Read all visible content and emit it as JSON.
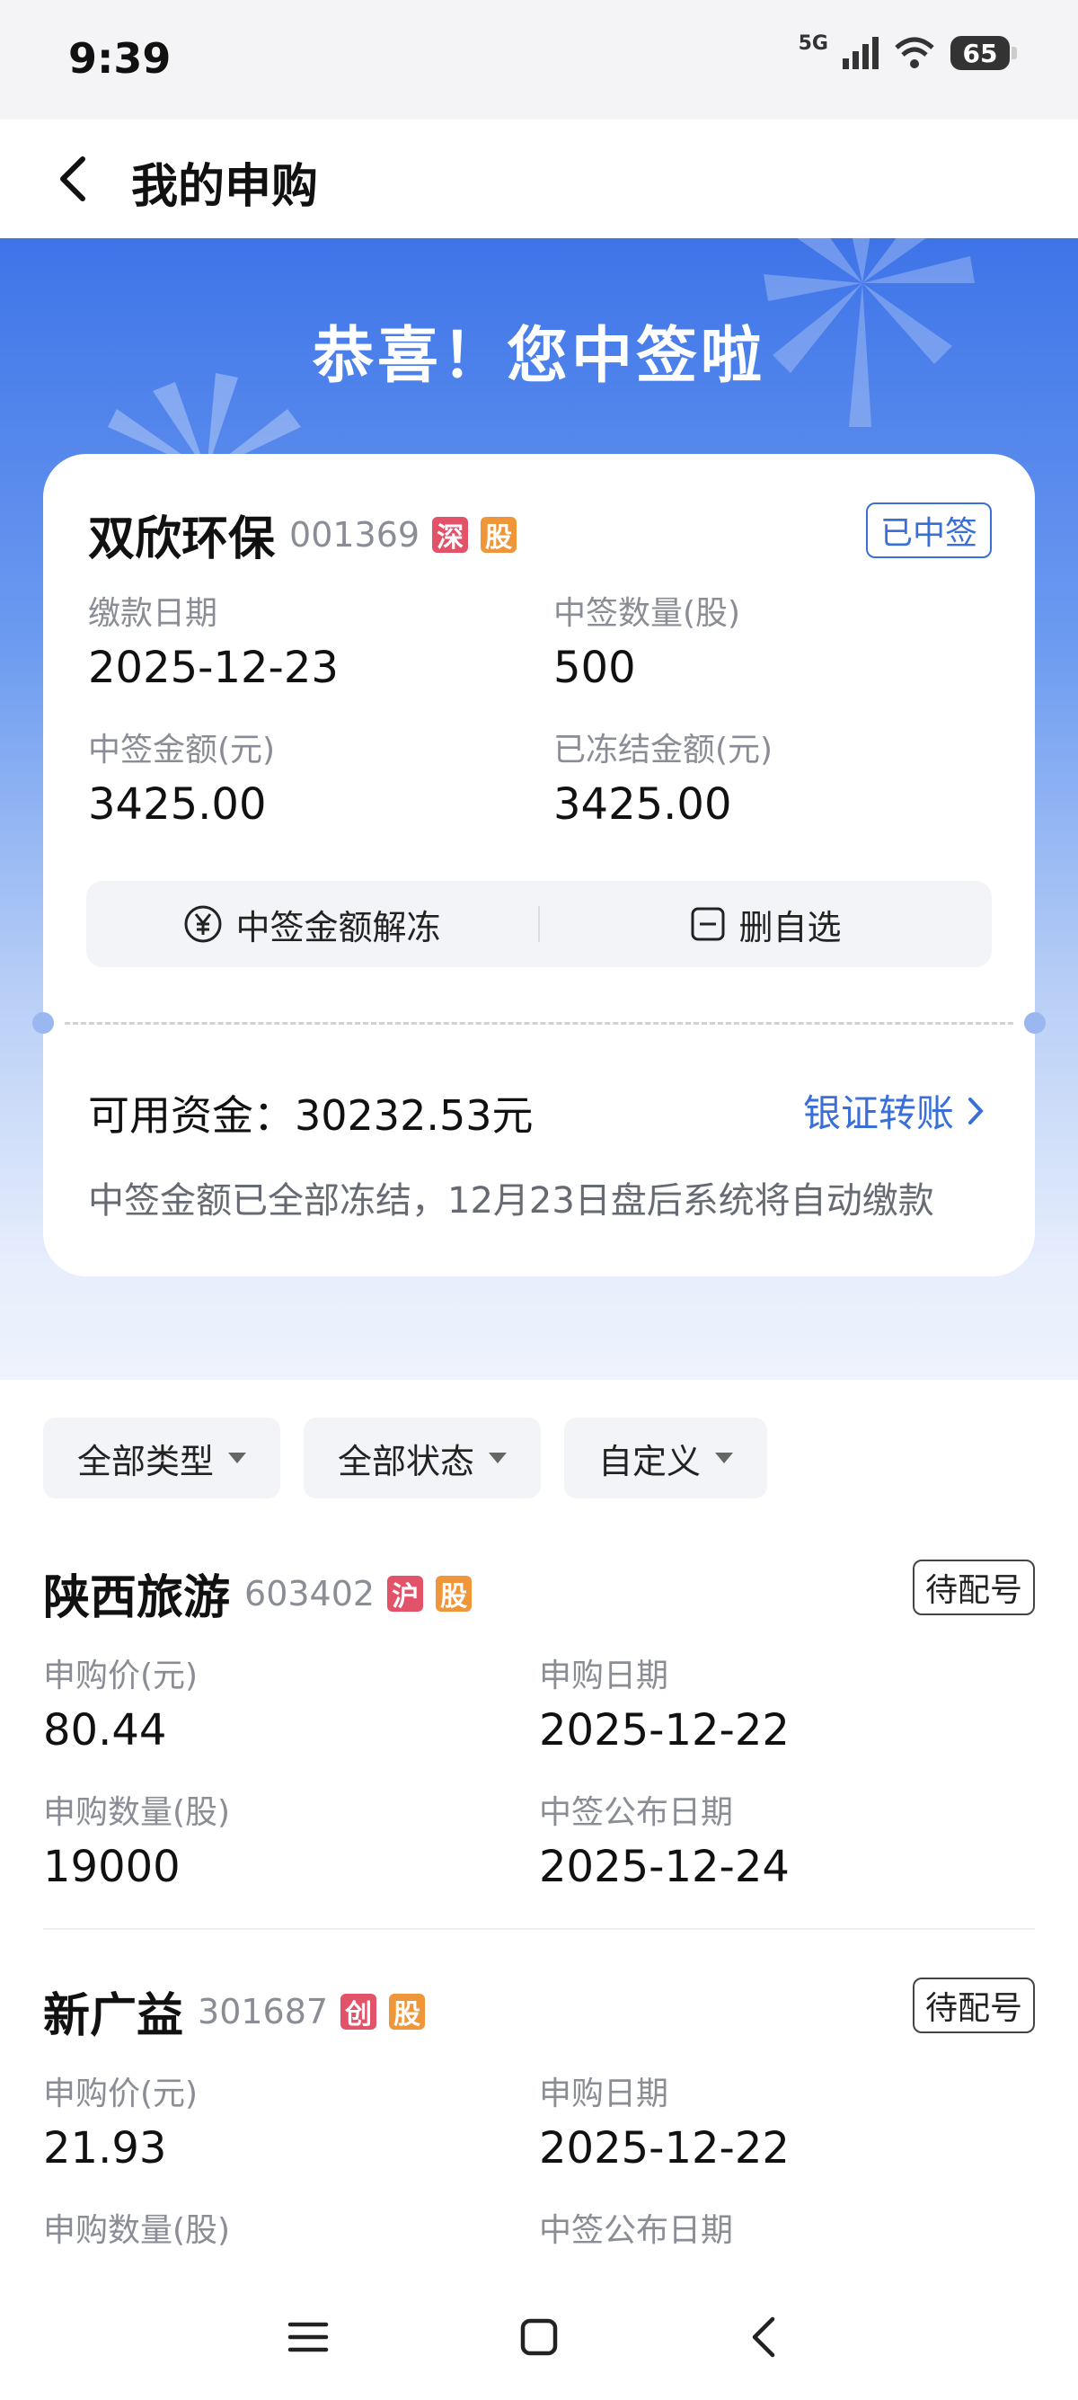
{
  "status_bar": {
    "time": "9:39",
    "network": "5G",
    "battery": "65"
  },
  "nav": {
    "title": "我的申购"
  },
  "hero": {
    "title": "恭喜！您中签啦"
  },
  "winning_card": {
    "name": "双欣环保",
    "code": "001369",
    "tags": [
      "深",
      "股"
    ],
    "status": "已中签",
    "fields": [
      {
        "label": "缴款日期",
        "value": "2025-12-23"
      },
      {
        "label": "中签数量(股)",
        "value": "500"
      },
      {
        "label": "中签金额(元)",
        "value": "3425.00"
      },
      {
        "label": "已冻结金额(元)",
        "value": "3425.00"
      }
    ],
    "actions": [
      {
        "label": "中签金额解冻",
        "icon": "yuan-circle-icon"
      },
      {
        "label": "删自选",
        "icon": "minus-box-icon"
      }
    ],
    "funds_text": "可用资金：30232.53元",
    "transfer_label": "银证转账",
    "note": "中签金额已全部冻结，12月23日盘后系统将自动缴款"
  },
  "filters": [
    {
      "label": "全部类型"
    },
    {
      "label": "全部状态"
    },
    {
      "label": "自定义"
    }
  ],
  "items": [
    {
      "name": "陕西旅游",
      "code": "603402",
      "tags": [
        "沪",
        "股"
      ],
      "status": "待配号",
      "fields": [
        {
          "label": "申购价(元)",
          "value": "80.44"
        },
        {
          "label": "申购日期",
          "value": "2025-12-22"
        },
        {
          "label": "申购数量(股)",
          "value": "19000"
        },
        {
          "label": "中签公布日期",
          "value": "2025-12-24"
        }
      ]
    },
    {
      "name": "新广益",
      "code": "301687",
      "tags": [
        "创",
        "股"
      ],
      "status": "待配号",
      "fields": [
        {
          "label": "申购价(元)",
          "value": "21.93"
        },
        {
          "label": "申购日期",
          "value": "2025-12-22"
        },
        {
          "label": "申购数量(股)",
          "value": ""
        },
        {
          "label": "中签公布日期",
          "value": ""
        }
      ]
    }
  ],
  "colors": {
    "accent": "#3a6fd8",
    "tag_red": "#e2536a",
    "tag_orange": "#f0963a"
  }
}
